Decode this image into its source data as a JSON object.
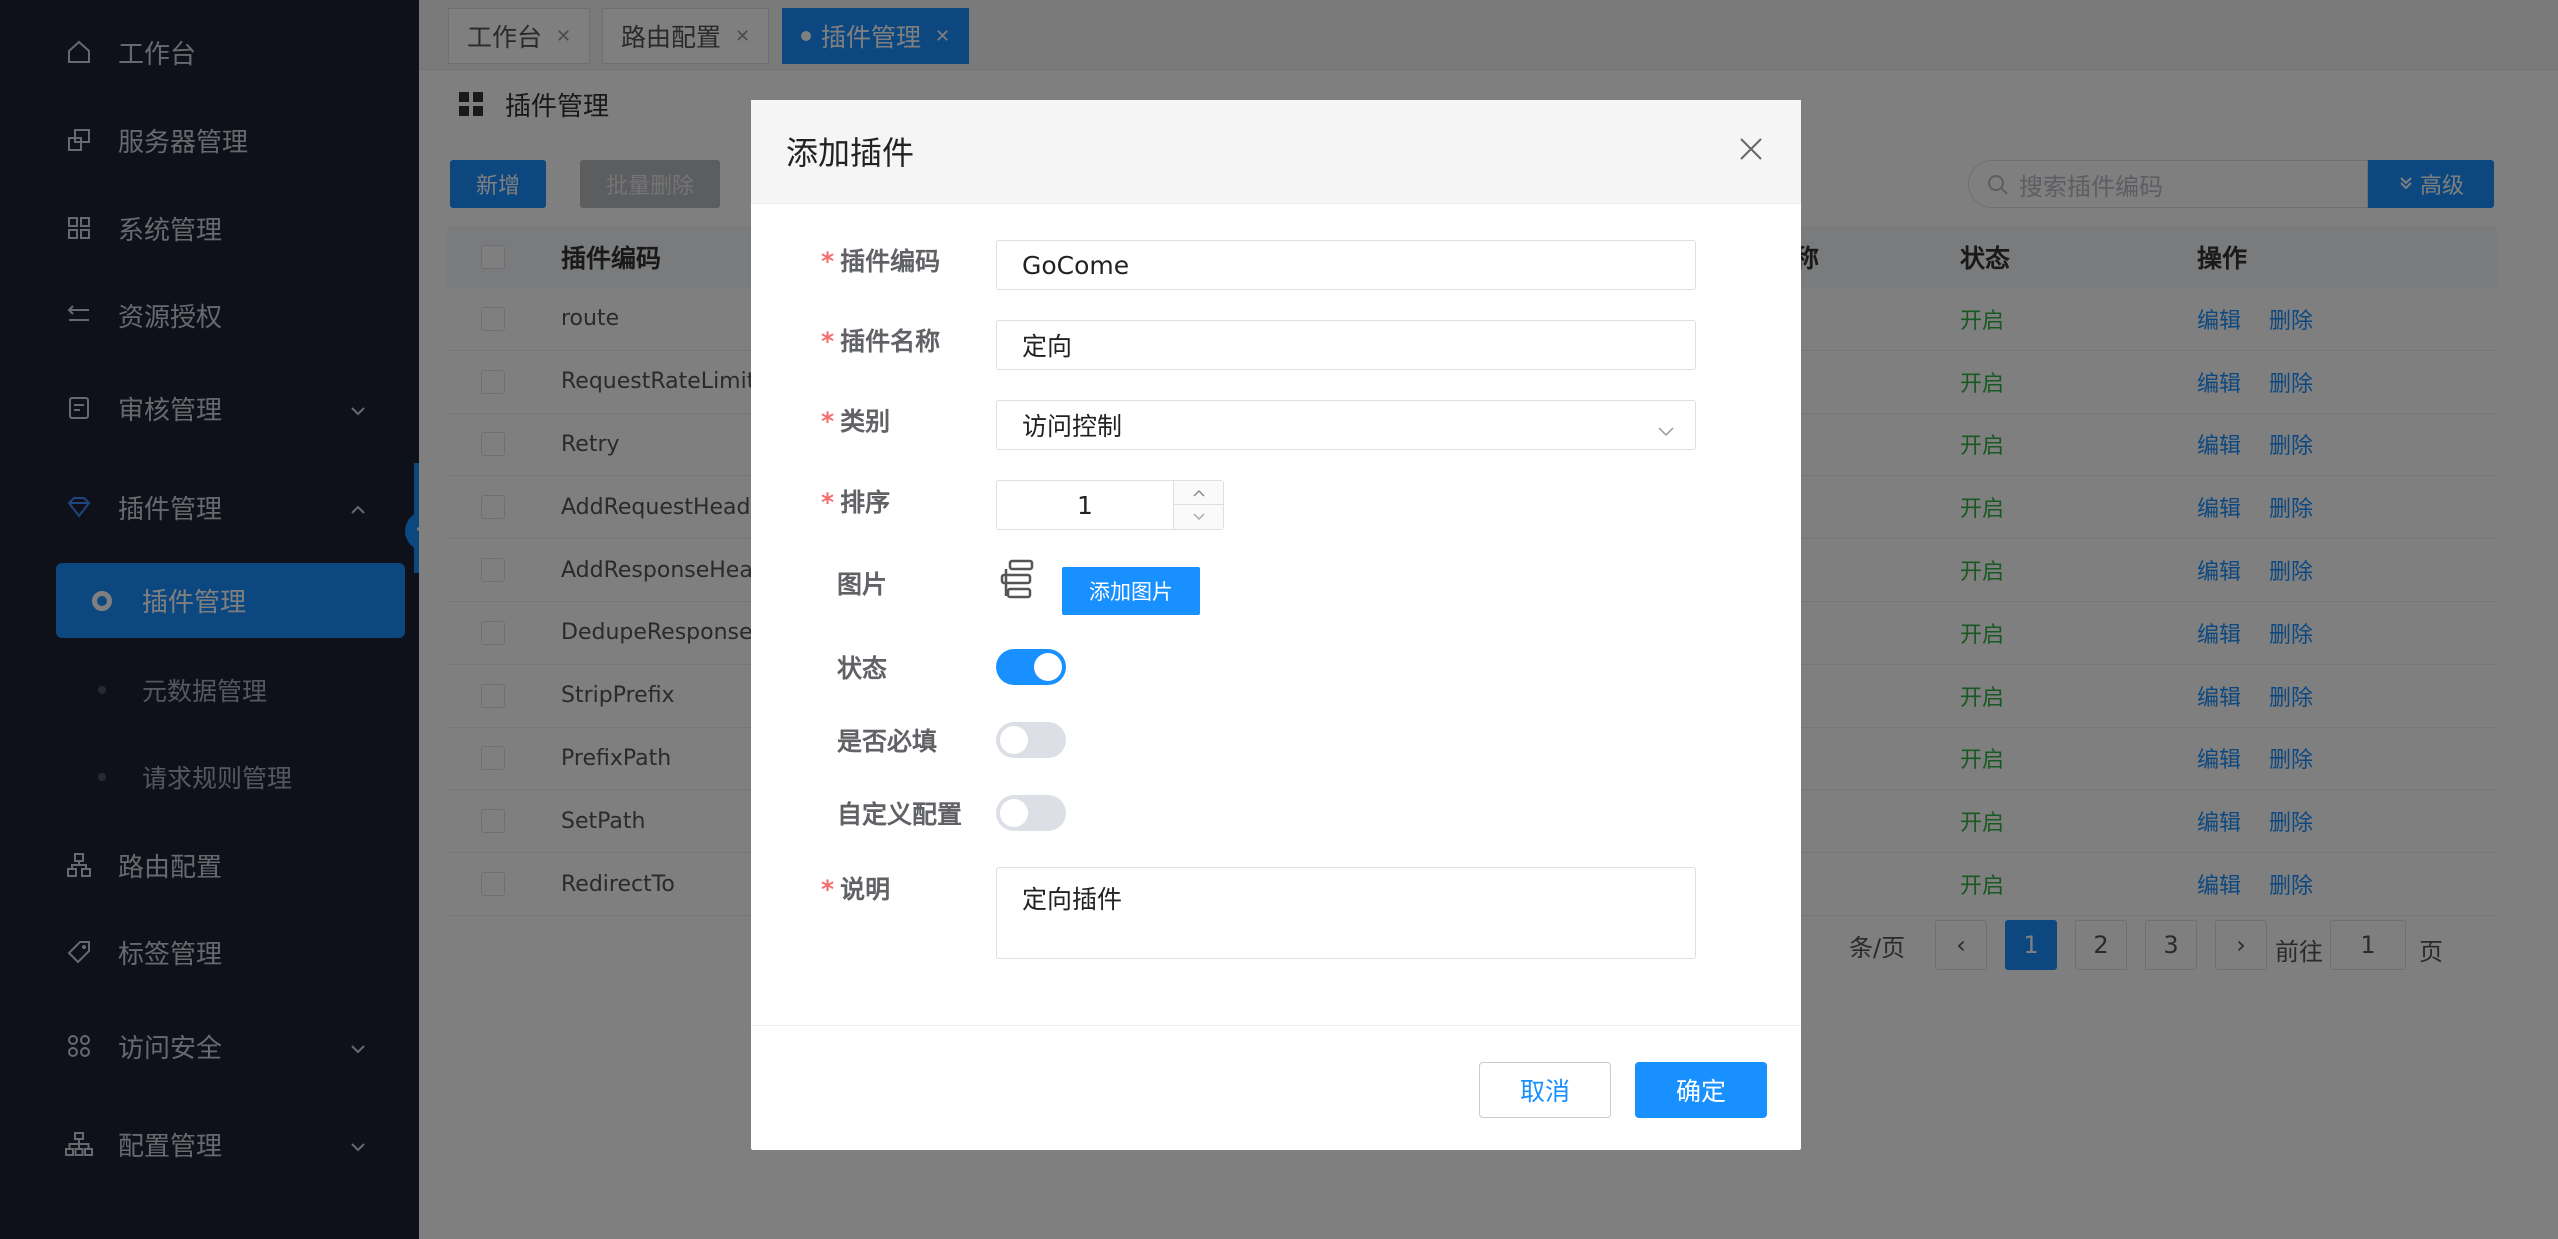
{
  "sidebar": {
    "items": [
      {
        "label": "工作台"
      },
      {
        "label": "服务器管理"
      },
      {
        "label": "系统管理"
      },
      {
        "label": "资源授权"
      },
      {
        "label": "审核管理"
      },
      {
        "label": "插件管理"
      },
      {
        "label": "路由配置"
      },
      {
        "label": "标签管理"
      },
      {
        "label": "访问安全"
      },
      {
        "label": "配置管理"
      }
    ],
    "sub_items": [
      {
        "label": "插件管理"
      },
      {
        "label": "元数据管理"
      },
      {
        "label": "请求规则管理"
      }
    ]
  },
  "tabs": [
    {
      "label": "工作台"
    },
    {
      "label": "路由配置"
    },
    {
      "label": "插件管理"
    }
  ],
  "page": {
    "title": "插件管理",
    "new_label": "新增",
    "batch_delete_label": "批量删除",
    "search_placeholder": "搜索插件编码",
    "advanced_label": "高级"
  },
  "table": {
    "headers": {
      "code": "插件编码",
      "status": "状态",
      "ops": "操作",
      "partial": "称"
    },
    "rows": [
      {
        "code": "route",
        "status": "开启",
        "edit": "编辑",
        "del": "删除"
      },
      {
        "code": "RequestRateLimiter",
        "status": "开启",
        "edit": "编辑",
        "del": "删除"
      },
      {
        "code": "Retry",
        "status": "开启",
        "edit": "编辑",
        "del": "删除"
      },
      {
        "code": "AddRequestHeader",
        "status": "开启",
        "edit": "编辑",
        "del": "删除"
      },
      {
        "code": "AddResponseHeade",
        "status": "开启",
        "edit": "编辑",
        "del": "删除"
      },
      {
        "code": "DedupeResponseHe",
        "status": "开启",
        "edit": "编辑",
        "del": "删除"
      },
      {
        "code": "StripPrefix",
        "status": "开启",
        "edit": "编辑",
        "del": "删除"
      },
      {
        "code": "PrefixPath",
        "status": "开启",
        "edit": "编辑",
        "del": "删除"
      },
      {
        "code": "SetPath",
        "status": "开启",
        "edit": "编辑",
        "del": "删除"
      },
      {
        "code": "RedirectTo",
        "status": "开启",
        "edit": "编辑",
        "del": "删除"
      }
    ]
  },
  "pager": {
    "page_size_partial": "条/页",
    "pages": [
      "1",
      "2",
      "3"
    ],
    "goto_label": "前往",
    "goto_value": "1",
    "page_unit": "页"
  },
  "dialog": {
    "title": "添加插件",
    "fields": {
      "code_label": "插件编码",
      "code_value": "GoCome",
      "name_label": "插件名称",
      "name_value": "定向",
      "category_label": "类别",
      "category_value": "访问控制",
      "sort_label": "排序",
      "sort_value": "1",
      "image_label": "图片",
      "add_image_label": "添加图片",
      "status_label": "状态",
      "required_label": "是否必填",
      "custom_label": "自定义配置",
      "desc_label": "说明",
      "desc_value": "定向插件"
    },
    "switches": {
      "status_on": true,
      "required_on": false,
      "custom_on": false
    },
    "cancel_label": "取消",
    "ok_label": "确定"
  },
  "colors": {
    "accent": "#1890ff",
    "sidebar_bg": "#1c2333",
    "status_green": "#2fb344",
    "required_red": "#f56c6c"
  }
}
